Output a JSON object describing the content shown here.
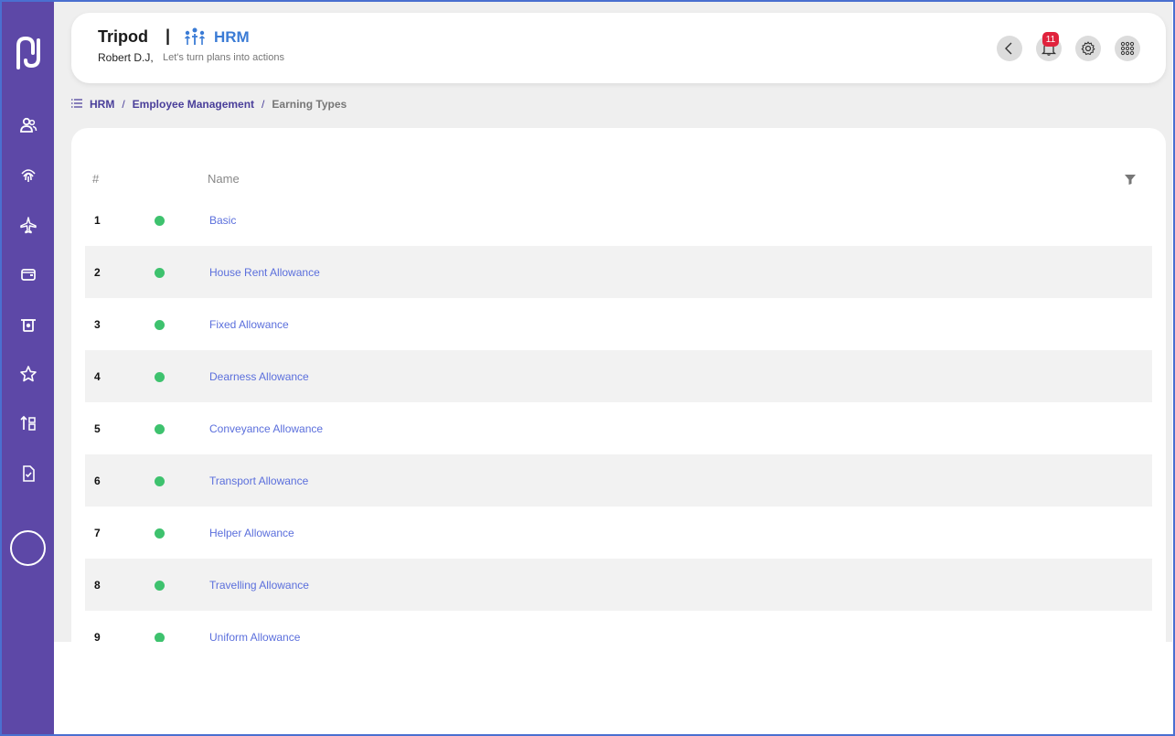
{
  "header": {
    "app_name": "Tripod",
    "separator": "|",
    "module_name": "HRM",
    "user_name": "Robert D.J,",
    "tagline": "Let's turn plans into actions",
    "notification_count": "11"
  },
  "breadcrumb": {
    "items": [
      "HRM",
      "Employee Management",
      "Earning Types"
    ],
    "separator": "/"
  },
  "table": {
    "columns": [
      "#",
      "Name"
    ],
    "rows": [
      {
        "num": "1",
        "name": "Basic"
      },
      {
        "num": "2",
        "name": "House Rent Allowance"
      },
      {
        "num": "3",
        "name": "Fixed Allowance"
      },
      {
        "num": "4",
        "name": "Dearness Allowance"
      },
      {
        "num": "5",
        "name": "Conveyance Allowance"
      },
      {
        "num": "6",
        "name": "Transport Allowance"
      },
      {
        "num": "7",
        "name": "Helper Allowance"
      },
      {
        "num": "8",
        "name": "Travelling Allowance"
      },
      {
        "num": "9",
        "name": "Uniform Allowance"
      }
    ]
  },
  "sidebar": {
    "icons": [
      "users-icon",
      "fingerprint-icon",
      "plane-icon",
      "wallet-icon",
      "atm-icon",
      "star-icon",
      "sort-icon",
      "document-check-icon"
    ]
  },
  "colors": {
    "sidebar": "#5d48a7",
    "accent": "#3a7bd5",
    "link": "#5b6fdc",
    "status_active": "#3ec26e",
    "badge": "#e0223c"
  }
}
